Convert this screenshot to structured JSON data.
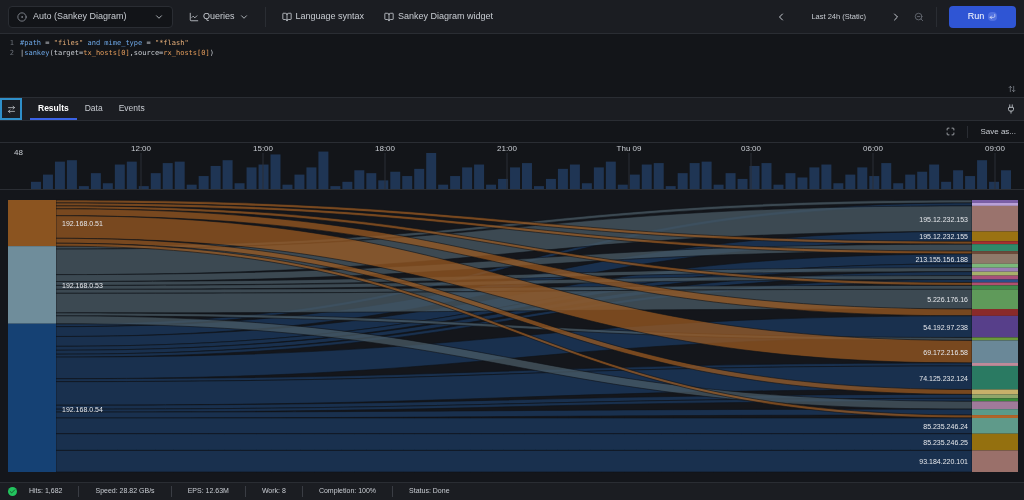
{
  "toolbar": {
    "mode_select": "Auto (Sankey Diagram)",
    "queries": "Queries",
    "links": [
      "Language syntax",
      "Sankey Diagram widget"
    ],
    "time_range": "Last 24h (Static)",
    "run": "Run"
  },
  "editor": {
    "lines": [
      {
        "number": "1",
        "tokens": [
          {
            "kind": "field",
            "text": "#path"
          },
          {
            "kind": "plain",
            "text": " = "
          },
          {
            "kind": "string",
            "text": "\"files\""
          },
          {
            "kind": "keyword",
            "text": " and "
          },
          {
            "kind": "field",
            "text": "mime_type"
          },
          {
            "kind": "plain",
            "text": " = "
          },
          {
            "kind": "string",
            "text": "\"*flash\""
          }
        ]
      },
      {
        "number": "2",
        "tokens": [
          {
            "kind": "plain",
            "text": "|"
          },
          {
            "kind": "function",
            "text": "sankey"
          },
          {
            "kind": "plain",
            "text": "(target="
          },
          {
            "kind": "arg",
            "text": "tx_hosts[0]"
          },
          {
            "kind": "plain",
            "text": ",source="
          },
          {
            "kind": "arg",
            "text": "rx_hosts[0]"
          },
          {
            "kind": "plain",
            "text": ")"
          }
        ]
      }
    ]
  },
  "tabs": [
    {
      "label": "Results",
      "selected": true
    },
    {
      "label": "Data",
      "selected": false
    },
    {
      "label": "Events",
      "selected": false
    }
  ],
  "save_as": "Save as...",
  "timeline": {
    "max_label": "48",
    "ticks": [
      "12:00",
      "15:00",
      "18:00",
      "21:00",
      "Thu 09",
      "03:00",
      "06:00",
      "09:00"
    ]
  },
  "sankey": {
    "sources": [
      {
        "label": "192.168.0.51",
        "color": "#8b5420"
      },
      {
        "label": "192.168.0.53",
        "color": "#6f8d9b"
      },
      {
        "label": "192.168.0.54",
        "color": "#154174"
      }
    ],
    "targets": [
      {
        "label": "195.12.232.153",
        "color": "#9a736d"
      },
      {
        "label": "195.12.232.155",
        "color": "#9a7212"
      },
      {
        "label": "213.155.156.188",
        "color": "#8f7a6a"
      },
      {
        "label": "5.226.176.16",
        "color": "#5f9a5a"
      },
      {
        "label": "54.192.97.238",
        "color": "#573f8a"
      },
      {
        "label": "69.172.216.58",
        "color": "#6a8898"
      },
      {
        "label": "74.125.232.124",
        "color": "#2a7a62"
      },
      {
        "label": "85.235.246.24",
        "color": "#5f9a8a"
      },
      {
        "label": "85.235.246.25",
        "color": "#94700f"
      },
      {
        "label": "93.184.220.101",
        "color": "#9a706a"
      }
    ]
  },
  "status_bar": {
    "ok": true,
    "items": [
      "Hits: 1,682",
      "Speed: 28.82 GB/s",
      "EPS: 12.63M",
      "Work: 8",
      "Completion: 100%",
      "Status: Done"
    ]
  }
}
